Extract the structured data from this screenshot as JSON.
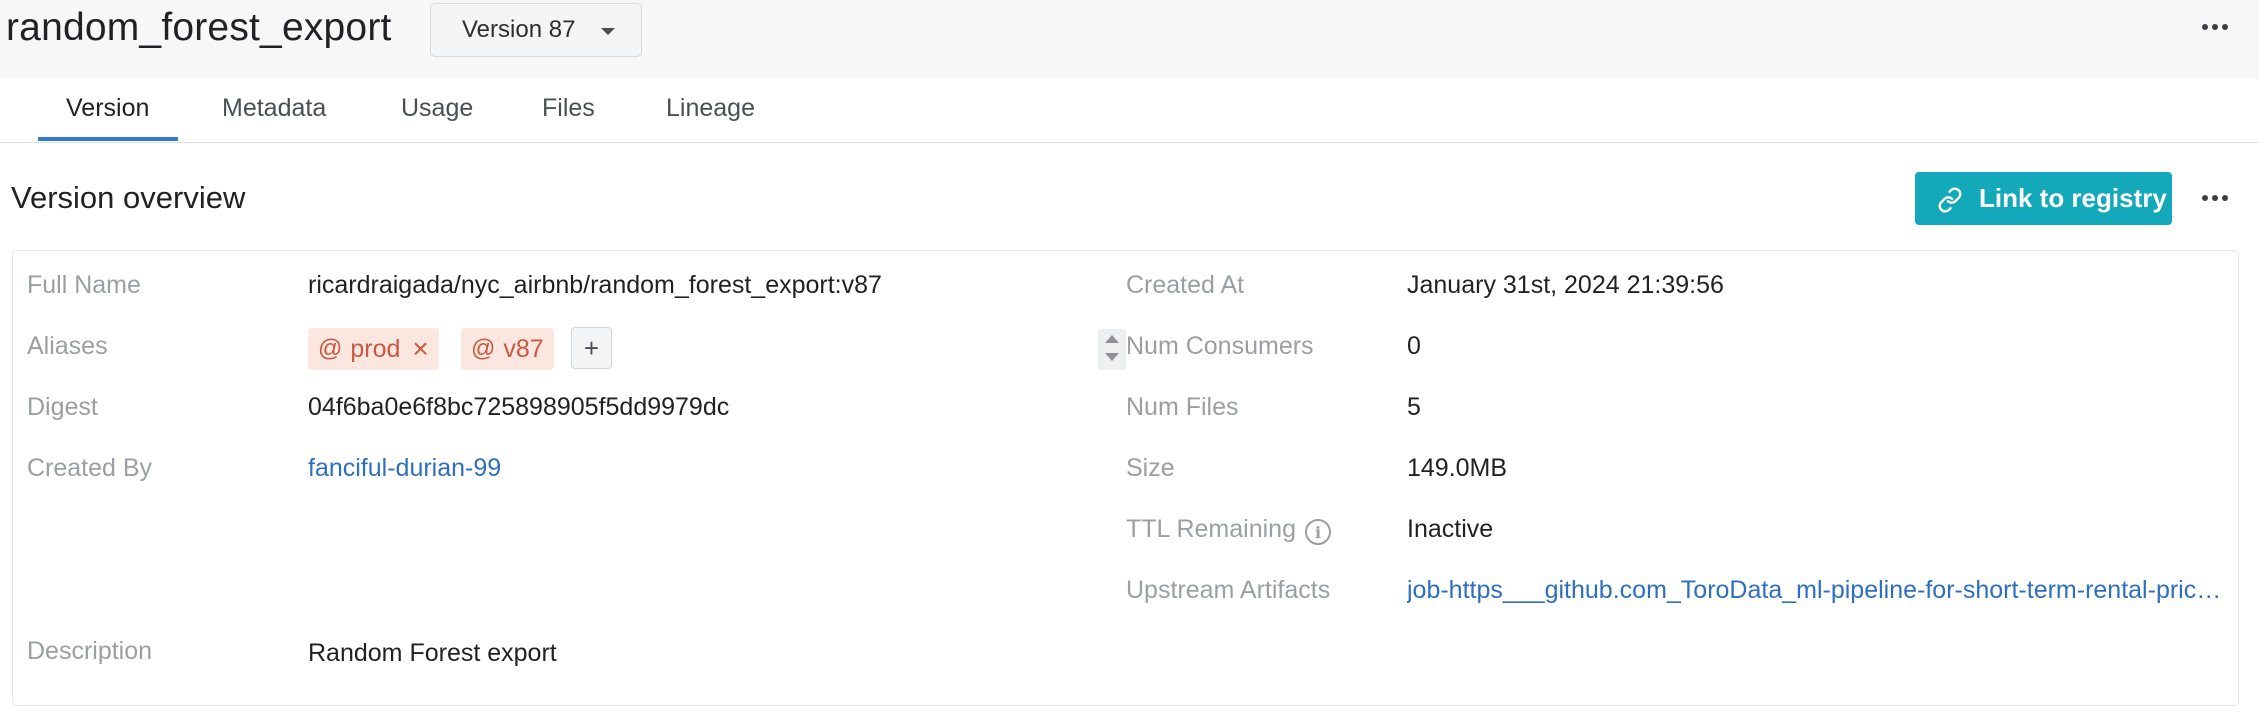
{
  "header": {
    "title": "random_forest_export",
    "version_select": "Version 87",
    "more_icon": "more-horizontal-icon"
  },
  "tabs": [
    {
      "label": "Version",
      "active": true
    },
    {
      "label": "Metadata",
      "active": false
    },
    {
      "label": "Usage",
      "active": false
    },
    {
      "label": "Files",
      "active": false
    },
    {
      "label": "Lineage",
      "active": false
    }
  ],
  "overview": {
    "title": "Version overview",
    "link_button": "Link to registry",
    "link_icon": "link-icon",
    "accent_color": "#13a9ba"
  },
  "details": {
    "full_name_label": "Full Name",
    "full_name": "ricardraigada/nyc_airbnb/random_forest_export:v87",
    "aliases_label": "Aliases",
    "aliases": [
      {
        "at": "@",
        "name": "prod",
        "removable": true
      },
      {
        "at": "@",
        "name": "v87",
        "removable": false
      }
    ],
    "add_alias": "+",
    "digest_label": "Digest",
    "digest": "04f6ba0e6f8bc725898905f5dd9979dc",
    "created_by_label": "Created By",
    "created_by": "fanciful-durian-99",
    "description_label": "Description",
    "description": "Random Forest export",
    "created_at_label": "Created At",
    "created_at": "January 31st, 2024 21:39:56",
    "num_consumers_label": "Num Consumers",
    "num_consumers": "0",
    "num_files_label": "Num Files",
    "num_files": "5",
    "size_label": "Size",
    "size": "149.0MB",
    "ttl_label": "TTL Remaining",
    "ttl_info": "i",
    "ttl": "Inactive",
    "upstream_label": "Upstream Artifacts",
    "upstream": "job-https___github.com_ToroData_ml-pipeline-for-short-term-rental-prices.git_components_train_random_forest_run.py"
  }
}
